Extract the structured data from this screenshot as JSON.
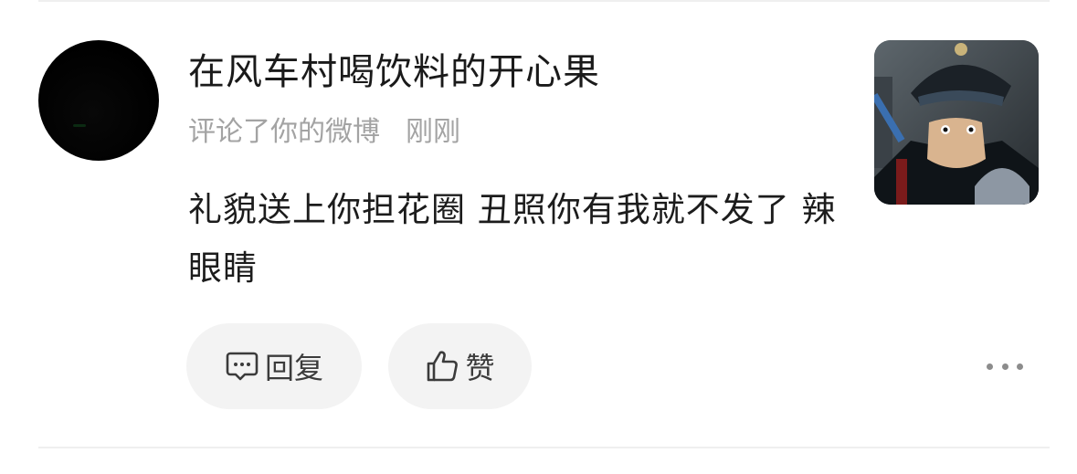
{
  "comment": {
    "username": "在风车村喝饮料的开心果",
    "action": "评论了你的微博",
    "time": "刚刚",
    "text": "礼貌送上你担花圈  丑照你有我就不发了 辣眼睛"
  },
  "actions": {
    "reply_label": "回复",
    "like_label": "赞"
  },
  "icons": {
    "reply": "comment-bubble-icon",
    "like": "thumbs-up-icon",
    "more": "more-dots-icon"
  },
  "colors": {
    "username": "#1a1a1a",
    "meta": "#a3a3a3",
    "pill_bg": "#f3f3f3",
    "divider": "#efefef"
  }
}
